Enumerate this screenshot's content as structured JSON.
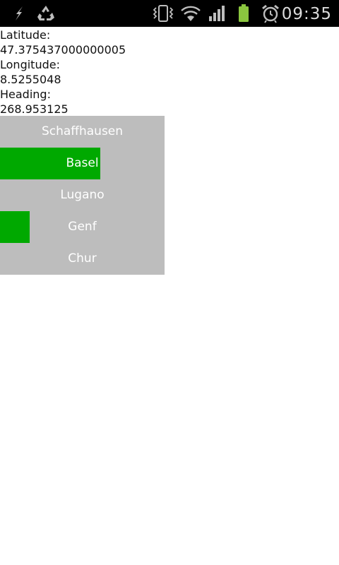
{
  "status_bar": {
    "time": "09:35",
    "icons": [
      "flash-icon",
      "recycle-icon",
      "vibrate-icon",
      "wifi-icon",
      "signal-icon",
      "battery-icon",
      "alarm-icon"
    ],
    "battery_color": "#8bc63f"
  },
  "location": {
    "latitude_label": "Latitude:",
    "latitude_value": "47.375437000000005",
    "longitude_label": "Longitude:",
    "longitude_value": "8.5255048",
    "heading_label": "Heading:",
    "heading_value": "268.953125"
  },
  "cities": [
    {
      "name": "Schaffhausen",
      "level": 0
    },
    {
      "name": "Basel",
      "level": 0.61
    },
    {
      "name": "Lugano",
      "level": 0
    },
    {
      "name": "Genf",
      "level": 0.18
    },
    {
      "name": "Chur",
      "level": 0
    }
  ],
  "colors": {
    "panel_background": "#bdbdbd",
    "bar_fill": "#00a900",
    "status_bar": "#000000"
  }
}
